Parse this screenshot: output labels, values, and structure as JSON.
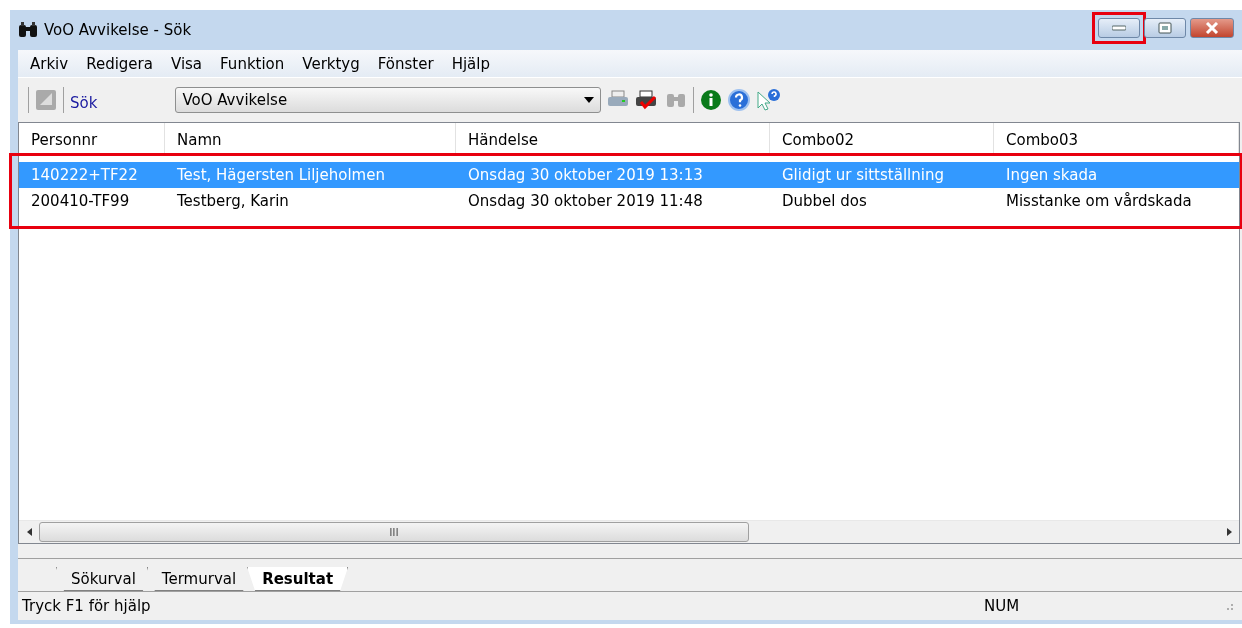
{
  "window": {
    "title": "VoO Avvikelse - Sök",
    "controls": [
      {
        "kind": "minimize",
        "highlighted": true
      },
      {
        "kind": "maximize",
        "highlighted": false
      },
      {
        "kind": "close",
        "highlighted": false
      }
    ]
  },
  "menu": [
    "Arkiv",
    "Redigera",
    "Visa",
    "Funktion",
    "Verktyg",
    "Fönster",
    "Hjälp"
  ],
  "toolbar": {
    "search_label": "Sök",
    "dropdown_value": "VoO Avvikelse",
    "tools": [
      {
        "kind": "print",
        "disabled": false
      },
      {
        "kind": "print-check",
        "disabled": false
      },
      {
        "kind": "find",
        "disabled": true
      }
    ],
    "help_tools": [
      {
        "kind": "info",
        "disabled": false
      },
      {
        "kind": "help",
        "disabled": false
      },
      {
        "kind": "context-help",
        "disabled": false
      }
    ]
  },
  "table": {
    "highlighted": true,
    "columns": [
      "Personnr",
      "Namn",
      "Händelse",
      "Combo02",
      "Combo03"
    ],
    "rows": [
      {
        "selected": true,
        "cells": [
          "140222+TF22",
          "Test, Hägersten Liljeholmen",
          "Onsdag 30 oktober 2019 13:13",
          "Glidigt ur sittställning",
          "Ingen skada"
        ]
      },
      {
        "selected": false,
        "cells": [
          "200410-TF99",
          "Testberg, Karin",
          "Onsdag 30 oktober 2019 11:48",
          "Dubbel dos",
          "Misstanke om vårdskada"
        ]
      }
    ]
  },
  "scrollbar_grip": "III",
  "tabs": [
    {
      "label": "Sökurval",
      "selected": false
    },
    {
      "label": "Termurval",
      "selected": false
    },
    {
      "label": "Resultat",
      "selected": true
    }
  ],
  "status_bar": {
    "message": "Tryck F1 för hjälp",
    "indicator": "NUM"
  }
}
